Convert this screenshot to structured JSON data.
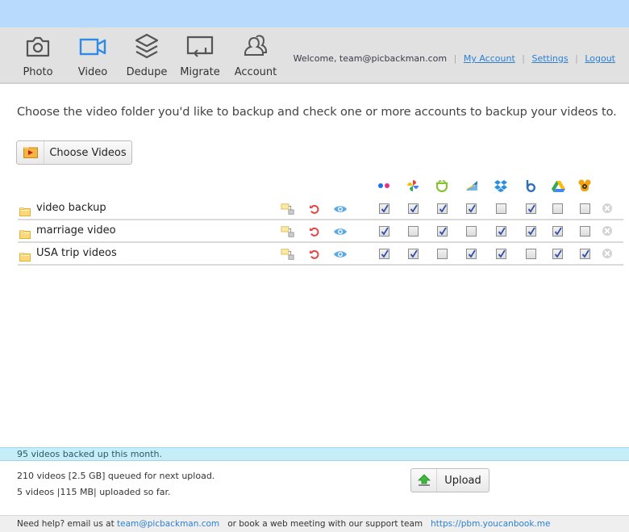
{
  "nav": {
    "items": [
      {
        "label": "Photo",
        "icon": "camera-icon",
        "active": false
      },
      {
        "label": "Video",
        "icon": "video-camera-icon",
        "active": true
      },
      {
        "label": "Dedupe",
        "icon": "layers-icon",
        "active": false
      },
      {
        "label": "Migrate",
        "icon": "migrate-icon",
        "active": false
      },
      {
        "label": "Account",
        "icon": "users-icon",
        "active": false
      }
    ],
    "welcome_text": "Welcome,  team@picbackman.com",
    "links": {
      "my_account": "My Account",
      "settings": "Settings",
      "logout": "Logout"
    }
  },
  "main": {
    "intro": "Choose the video folder you'd like to backup and check one or more accounts to backup your videos to.",
    "choose_button": "Choose Videos",
    "services": [
      "flickr",
      "google-photos",
      "smugmug",
      "zenfolio",
      "dropbox",
      "box",
      "google-drive",
      "500px"
    ],
    "folders": [
      {
        "name": "video backup",
        "checks": [
          true,
          true,
          true,
          true,
          false,
          true,
          false,
          false
        ]
      },
      {
        "name": "marriage video",
        "checks": [
          true,
          false,
          true,
          false,
          true,
          true,
          true,
          false
        ]
      },
      {
        "name": "USA trip videos",
        "checks": [
          true,
          true,
          false,
          true,
          true,
          false,
          true,
          true
        ]
      }
    ]
  },
  "status": {
    "monthly": "95 videos backed up this month.",
    "queued": "210 videos [2.5 GB] queued for next upload.",
    "uploaded": "5 videos |115 MB| uploaded so far.",
    "upload_button": "Upload"
  },
  "footer": {
    "help_prefix": "Need help? email us at ",
    "email": "team@picbackman.com",
    "middle": "  or book a web meeting with our support team  ",
    "link": "https://pbm.youcanbook.me"
  },
  "colors": {
    "accent": "#2c8ae8",
    "topbar": "#b7dafd",
    "nav_bg": "#e1e1e1",
    "status_bg": "#c6eef9"
  }
}
